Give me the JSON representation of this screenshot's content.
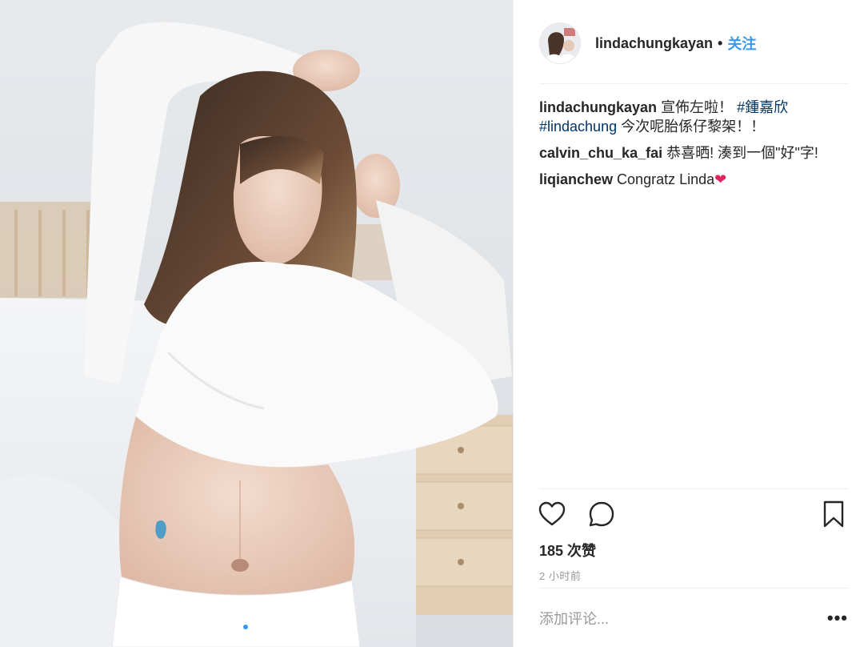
{
  "post": {
    "username": "lindachungkayan",
    "follow_label": "关注",
    "caption_text_1": "宣佈左啦！",
    "caption_tag_1": "#鍾嘉欣",
    "caption_tag_2": "#lindachung",
    "caption_text_2": "今次呢胎係仔黎架！！",
    "comments": [
      {
        "user": "calvin_chu_ka_fai",
        "text": "恭喜晒! 湊到一個\"好\"字!"
      },
      {
        "user": "liqianchew",
        "text": "Congratz Linda",
        "emoji": "❤"
      }
    ],
    "likes": "185 次赞",
    "time": "2 小时前",
    "add_comment_placeholder": "添加评论...",
    "more_label": "•••"
  },
  "icons": {
    "like": "heart-outline-icon",
    "comment": "speech-bubble-icon",
    "save": "bookmark-icon",
    "more": "ellipsis-icon"
  },
  "carousel": {
    "total": 2,
    "active": 1
  },
  "colors": {
    "accent": "#3897f0",
    "hashtag": "#003569",
    "muted": "#999999",
    "text": "#262626"
  }
}
